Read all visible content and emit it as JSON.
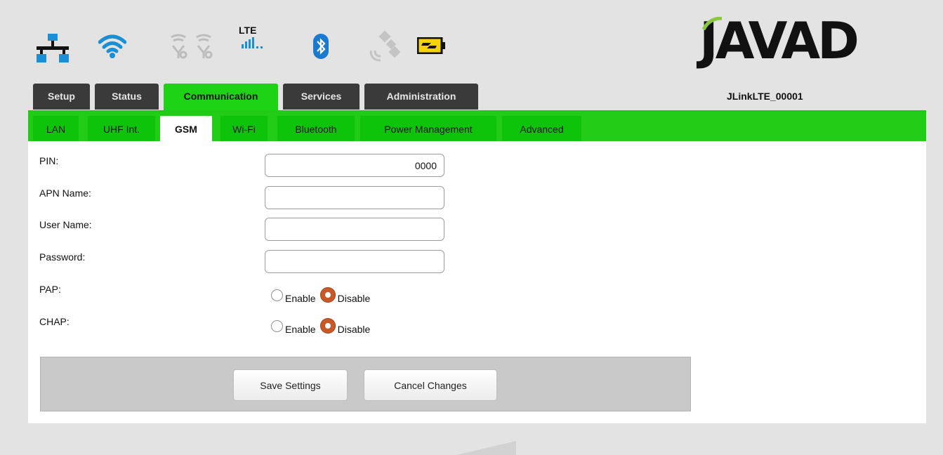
{
  "header": {
    "logo": "JAVAD",
    "device_name": "JLinkLTE_00001",
    "icons": [
      "network-icon",
      "wifi-icon",
      "uhf-antenna-icon",
      "lte-signal-icon",
      "bluetooth-icon",
      "satellite-icon",
      "battery-charging-icon"
    ],
    "lte_label": "LTE"
  },
  "main_tabs": [
    {
      "label": "Setup"
    },
    {
      "label": "Status"
    },
    {
      "label": "Communication",
      "active": true
    },
    {
      "label": "Services"
    },
    {
      "label": "Administration"
    }
  ],
  "sub_tabs": [
    {
      "label": "LAN"
    },
    {
      "label": "UHF Int."
    },
    {
      "label": "GSM",
      "active": true
    },
    {
      "label": "Wi-Fi"
    },
    {
      "label": "Bluetooth"
    },
    {
      "label": "Power Management"
    },
    {
      "label": "Advanced"
    }
  ],
  "form": {
    "pin": {
      "label": "PIN:",
      "value": "0000"
    },
    "apn": {
      "label": "APN Name:",
      "value": ""
    },
    "user": {
      "label": "User Name:",
      "value": ""
    },
    "password": {
      "label": "Password:",
      "value": ""
    },
    "pap": {
      "label": "PAP:",
      "enable": "Enable",
      "disable": "Disable",
      "selected": "Disable"
    },
    "chap": {
      "label": "CHAP:",
      "enable": "Enable",
      "disable": "Disable",
      "selected": "Disable"
    }
  },
  "buttons": {
    "save": "Save Settings",
    "cancel": "Cancel Changes"
  },
  "colors": {
    "accent_green": "#22cc16",
    "dark_tab": "#3a3a3a",
    "wifi_blue": "#1a8fd6",
    "radio_selected": "#c85a2a"
  }
}
